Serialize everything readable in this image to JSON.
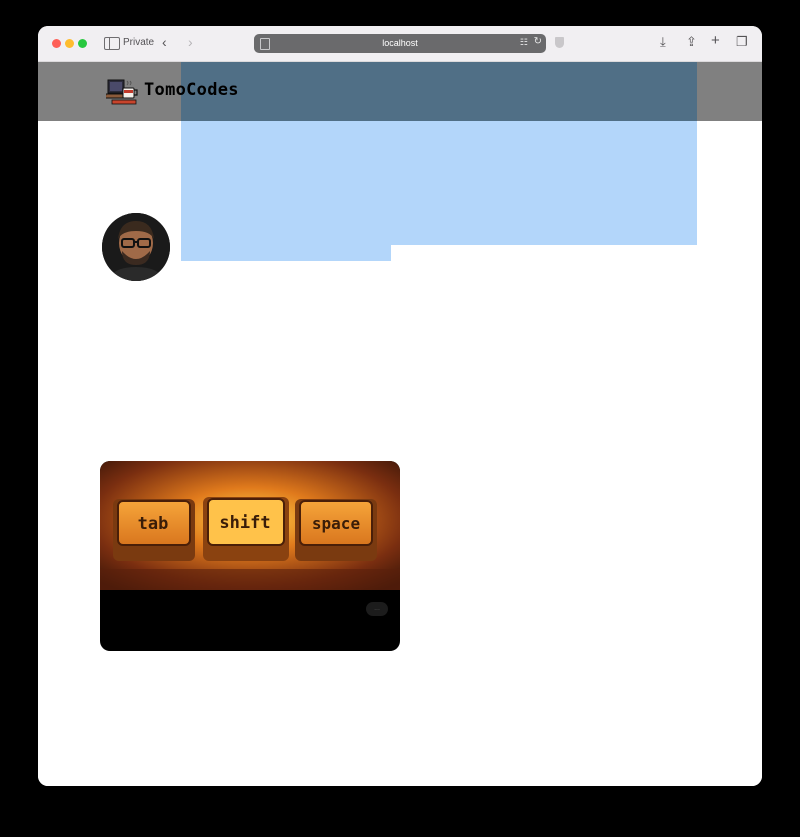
{
  "browser": {
    "private_label": "Private",
    "url": "localhost",
    "icons": [
      "sidebar-icon",
      "back-icon",
      "forward-icon",
      "page-icon",
      "translate-icon",
      "reload-icon",
      "shield-icon",
      "download-icon",
      "share-icon",
      "new-tab-icon",
      "tabs-icon"
    ]
  },
  "site": {
    "logo_text": "TomoCodes",
    "avatar_alt": "author-avatar"
  },
  "card": {
    "keys": [
      "tab",
      "shift",
      "space"
    ],
    "badge": "..."
  },
  "colors": {
    "header": "#808080",
    "selection": "#b3d6fa",
    "key_face": "#e8962c",
    "key_text": "#3a1d08"
  }
}
